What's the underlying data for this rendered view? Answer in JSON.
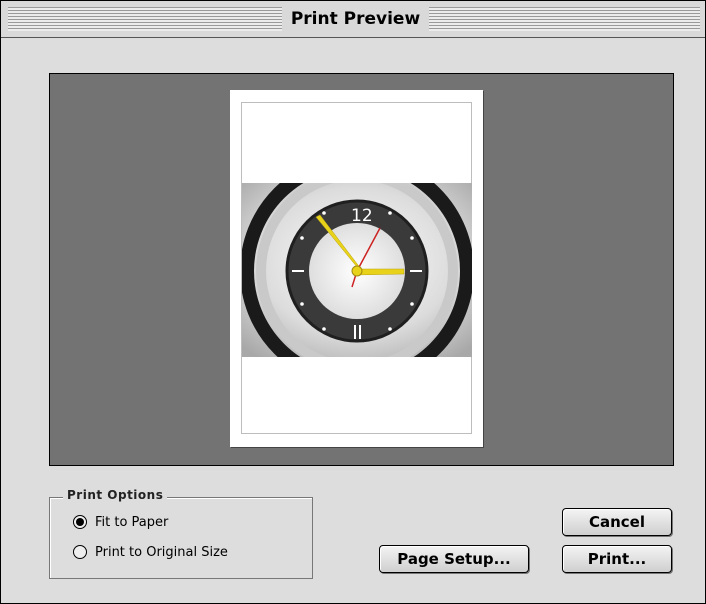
{
  "window": {
    "title": "Print Preview"
  },
  "print_options": {
    "legend": "Print Options",
    "options": [
      {
        "label": "Fit to Paper",
        "selected": true
      },
      {
        "label": "Print to Original Size",
        "selected": false
      }
    ]
  },
  "buttons": {
    "cancel": "Cancel",
    "page_setup": "Page Setup...",
    "print": "Print..."
  },
  "preview": {
    "image_subject": "wall clock photo",
    "clock_numeral": "12"
  },
  "colors": {
    "window_bg": "#dddddd",
    "preview_bg": "#737373",
    "paper": "#ffffff",
    "clock_hands": "#e8d21a",
    "second_hand": "#cc2222"
  }
}
